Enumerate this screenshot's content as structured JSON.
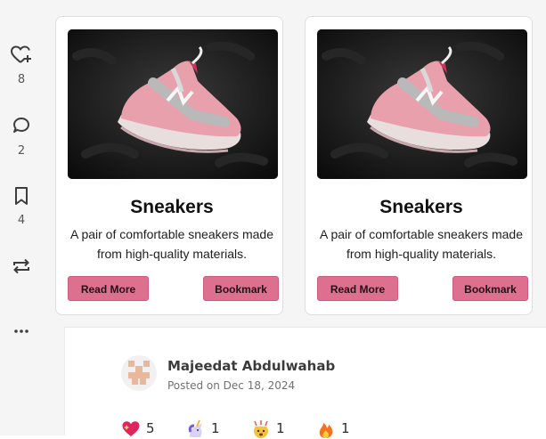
{
  "rail": {
    "heart_count": "8",
    "comment_count": "2",
    "bookmark_count": "4"
  },
  "cards": [
    {
      "title": "Sneakers",
      "description": "A pair of comfortable sneakers made from high-quality materials.",
      "read_more_label": "Read More",
      "bookmark_label": "Bookmark"
    },
    {
      "title": "Sneakers",
      "description": "A pair of comfortable sneakers made from high-quality materials.",
      "read_more_label": "Read More",
      "bookmark_label": "Bookmark"
    }
  ],
  "author": {
    "name": "Majeedat Abdulwahab",
    "posted": "Posted on Dec 18, 2024"
  },
  "reactions": [
    {
      "icon": "sparkle-heart-icon",
      "count": "5"
    },
    {
      "icon": "unicorn-icon",
      "count": "1"
    },
    {
      "icon": "exploding-head-icon",
      "count": "1"
    },
    {
      "icon": "fire-icon",
      "count": "1"
    }
  ],
  "colors": {
    "button_bg": "#dd6f8f",
    "rail_bg": "#f5f5f5"
  }
}
